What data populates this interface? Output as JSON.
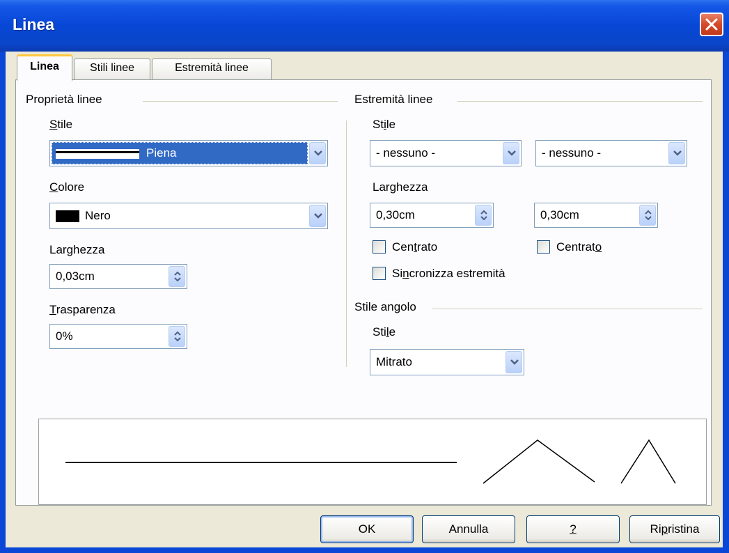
{
  "window": {
    "title": "Linea",
    "close_icon": "close-icon"
  },
  "tabs": [
    {
      "label": "Linea",
      "active": true
    },
    {
      "label": "Stili linee",
      "active": false
    },
    {
      "label": "Estremità linee",
      "active": false
    }
  ],
  "line_properties": {
    "group_label": "Proprietà linee",
    "style_label": "Stile",
    "style_value": "Piena",
    "color_label": "Colore",
    "color_value": "Nero",
    "color_swatch": "#000000",
    "width_label": "Larghezza",
    "width_value": "0,03cm",
    "transparency_label": "Trasparenza",
    "transparency_value": "0%"
  },
  "line_ends": {
    "group_label": "Estremità linee",
    "style_label": "Stile",
    "start_style": "- nessuno -",
    "end_style": "- nessuno -",
    "width_label": "Larghezza",
    "start_width": "0,30cm",
    "end_width": "0,30cm",
    "start_centered_label": "Centrato",
    "end_centered_label": "Centrato",
    "sync_label": "Sincronizza estremità"
  },
  "corner_style": {
    "group_label": "Stile angolo",
    "style_label": "Stile",
    "style_value": "Mitrato"
  },
  "buttons": {
    "ok": "OK",
    "cancel": "Annulla",
    "help": "?",
    "reset": "Ripristina"
  },
  "colors": {
    "title_bar": "#0a47d6",
    "selection": "#316ac5",
    "dialog_bg": "#ece9d8"
  }
}
